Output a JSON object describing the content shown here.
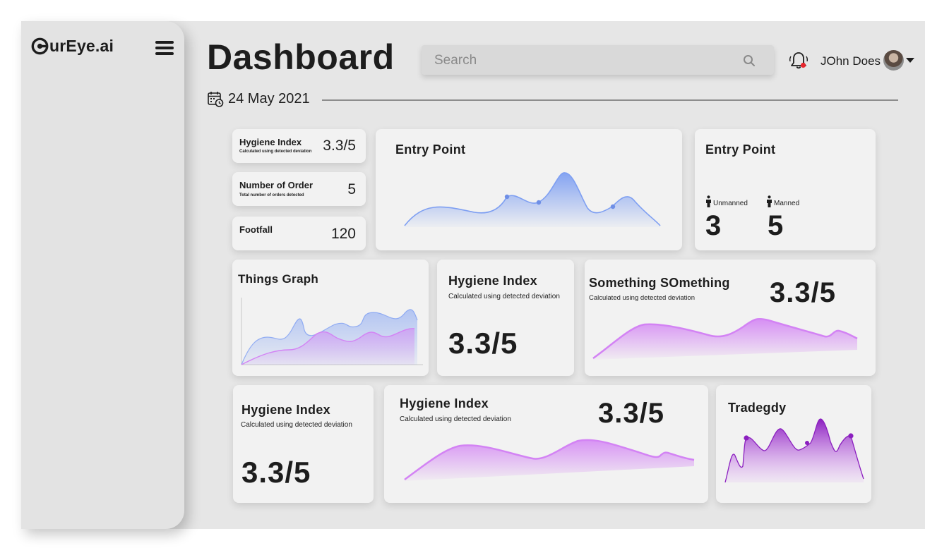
{
  "brand": {
    "name": "urEye.ai"
  },
  "header": {
    "title": "Dashboard",
    "search_placeholder": "Search",
    "user_name": "JOhn Does"
  },
  "date": "24 May 2021",
  "stats": [
    {
      "title": "Hygiene Index",
      "subtitle": "Calculated using detected deviation",
      "value": "3.3/5"
    },
    {
      "title": "Number of Order",
      "subtitle": "Total number of orders detected",
      "value": "5"
    },
    {
      "title": "Footfall",
      "value": "120"
    }
  ],
  "entry_chart": {
    "title": "Entry Point"
  },
  "entry_counts": {
    "title": "Entry Point",
    "unmanned_label": "Unmanned",
    "unmanned_value": "3",
    "manned_label": "Manned",
    "manned_value": "5"
  },
  "things_graph": {
    "title": "Things Graph"
  },
  "hygiene_card_1": {
    "title": "Hygiene Index",
    "subtitle": "Calculated using detected deviation",
    "value": "3.3/5"
  },
  "something_card": {
    "title": "Something  SOmething",
    "subtitle": "Calculated using detected deviation",
    "value": "3.3/5"
  },
  "hygiene_card_2": {
    "title": "Hygiene Index",
    "subtitle": "Calculated using detected deviation",
    "value": "3.3/5"
  },
  "hygiene_card_3": {
    "title": "Hygiene Index",
    "subtitle": "Calculated using detected deviation",
    "value": "3.3/5"
  },
  "tragedy_card": {
    "title": "Tradegdy"
  },
  "colors": {
    "blue": "#7e9ff2",
    "purple": "#d383f4",
    "deep_purple": "#8b1fbf",
    "text": "#1d1d1d"
  }
}
